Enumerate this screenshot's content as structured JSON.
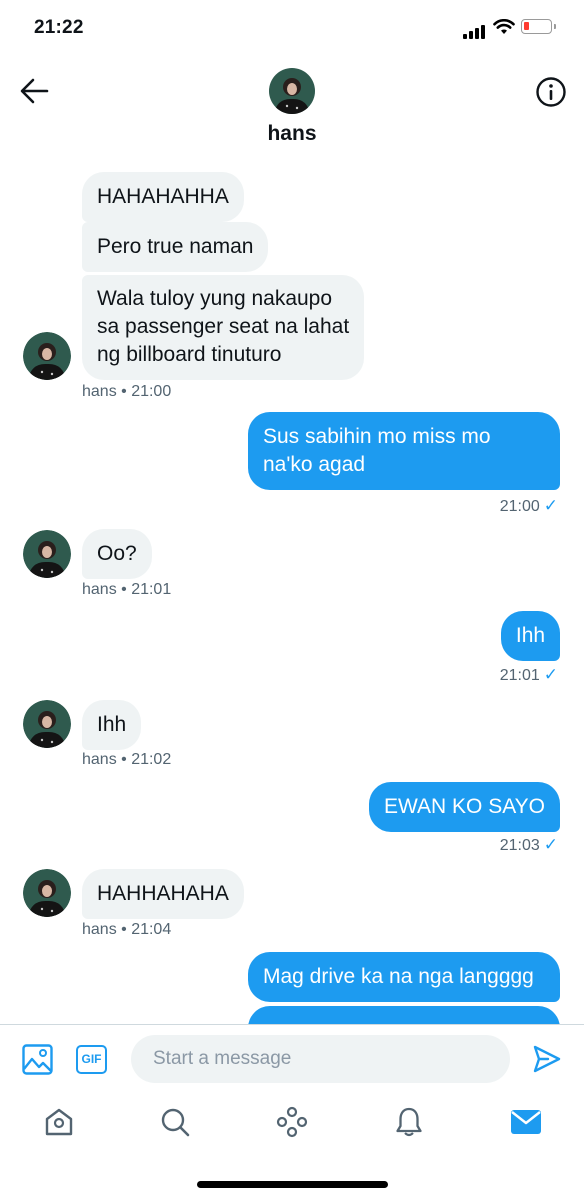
{
  "status_bar": {
    "time": "21:22"
  },
  "header": {
    "name": "hans"
  },
  "messages": [
    {
      "text": "HAHAHAHHA"
    },
    {
      "text": "Pero true naman"
    },
    {
      "lines": [
        "Wala tuloy yung nakaupo",
        "sa passenger seat na lahat",
        "ng billboard tinuturo"
      ],
      "meta": "hans • 21:00"
    },
    {
      "lines": [
        "Sus sabihin mo miss mo",
        "na'ko agad"
      ],
      "meta": "21:00"
    },
    {
      "text": "Oo?",
      "meta": "hans • 21:01"
    },
    {
      "text": "Ihh",
      "meta": "21:01"
    },
    {
      "text": "Ihh",
      "meta": "hans • 21:02"
    },
    {
      "text": "EWAN KO SAYO",
      "meta": "21:03"
    },
    {
      "text": "HAHHAHAHA",
      "meta": "hans • 21:04"
    },
    {
      "text": "Mag drive ka na nga langggg"
    }
  ],
  "composer": {
    "placeholder": "Start a message",
    "gif_label": "GIF"
  },
  "icons": {
    "back": "arrow-left-icon",
    "info": "info-icon",
    "media": "image-icon",
    "gif": "gif-icon",
    "send": "send-icon",
    "tab_home": "home-icon",
    "tab_search": "search-icon",
    "tab_spaces": "spaces-icon",
    "tab_notifications": "bell-icon",
    "tab_messages": "mail-icon"
  },
  "colors": {
    "accent": "#1d9bf0",
    "incoming_bubble": "#eff3f4",
    "meta_text": "#536471",
    "battery_low": "#ff3b30"
  }
}
